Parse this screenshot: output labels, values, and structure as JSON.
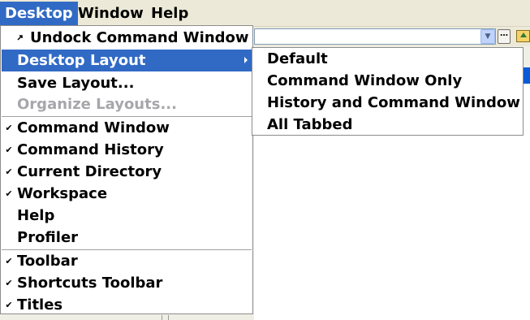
{
  "menubar": {
    "items": [
      {
        "label": "Desktop"
      },
      {
        "label": "Window"
      },
      {
        "label": "Help"
      }
    ]
  },
  "desktop_menu": {
    "undock": {
      "label": "Undock Command Window"
    },
    "layout": {
      "label": "Desktop Layout"
    },
    "save": {
      "label": "Save Layout..."
    },
    "organize": {
      "label": "Organize Layouts..."
    },
    "command_window": {
      "label": "Command Window",
      "checked": true
    },
    "command_history": {
      "label": "Command History",
      "checked": true
    },
    "current_directory": {
      "label": "Current Directory",
      "checked": true
    },
    "workspace": {
      "label": "Workspace",
      "checked": true
    },
    "help": {
      "label": "Help"
    },
    "profiler": {
      "label": "Profiler"
    },
    "toolbar": {
      "label": "Toolbar",
      "checked": true
    },
    "shortcuts_toolbar": {
      "label": "Shortcuts Toolbar",
      "checked": true
    },
    "titles": {
      "label": "Titles",
      "checked": true
    }
  },
  "layout_submenu": {
    "items": [
      {
        "label": "Default"
      },
      {
        "label": "Command Window Only"
      },
      {
        "label": "History and Command Window"
      },
      {
        "label": "All Tabbed"
      }
    ]
  },
  "icons": {
    "check": "✔",
    "undock": "undock-arrow-icon",
    "submenu_arrow": "chevron-right-icon",
    "combo_dropdown": "chevron-down-icon",
    "browse": "ellipsis-icon",
    "up_folder": "up-folder-icon"
  },
  "colors": {
    "highlight": "#316ac5",
    "menubar": "#ece9d8",
    "disabled": "#a7a6aa"
  }
}
